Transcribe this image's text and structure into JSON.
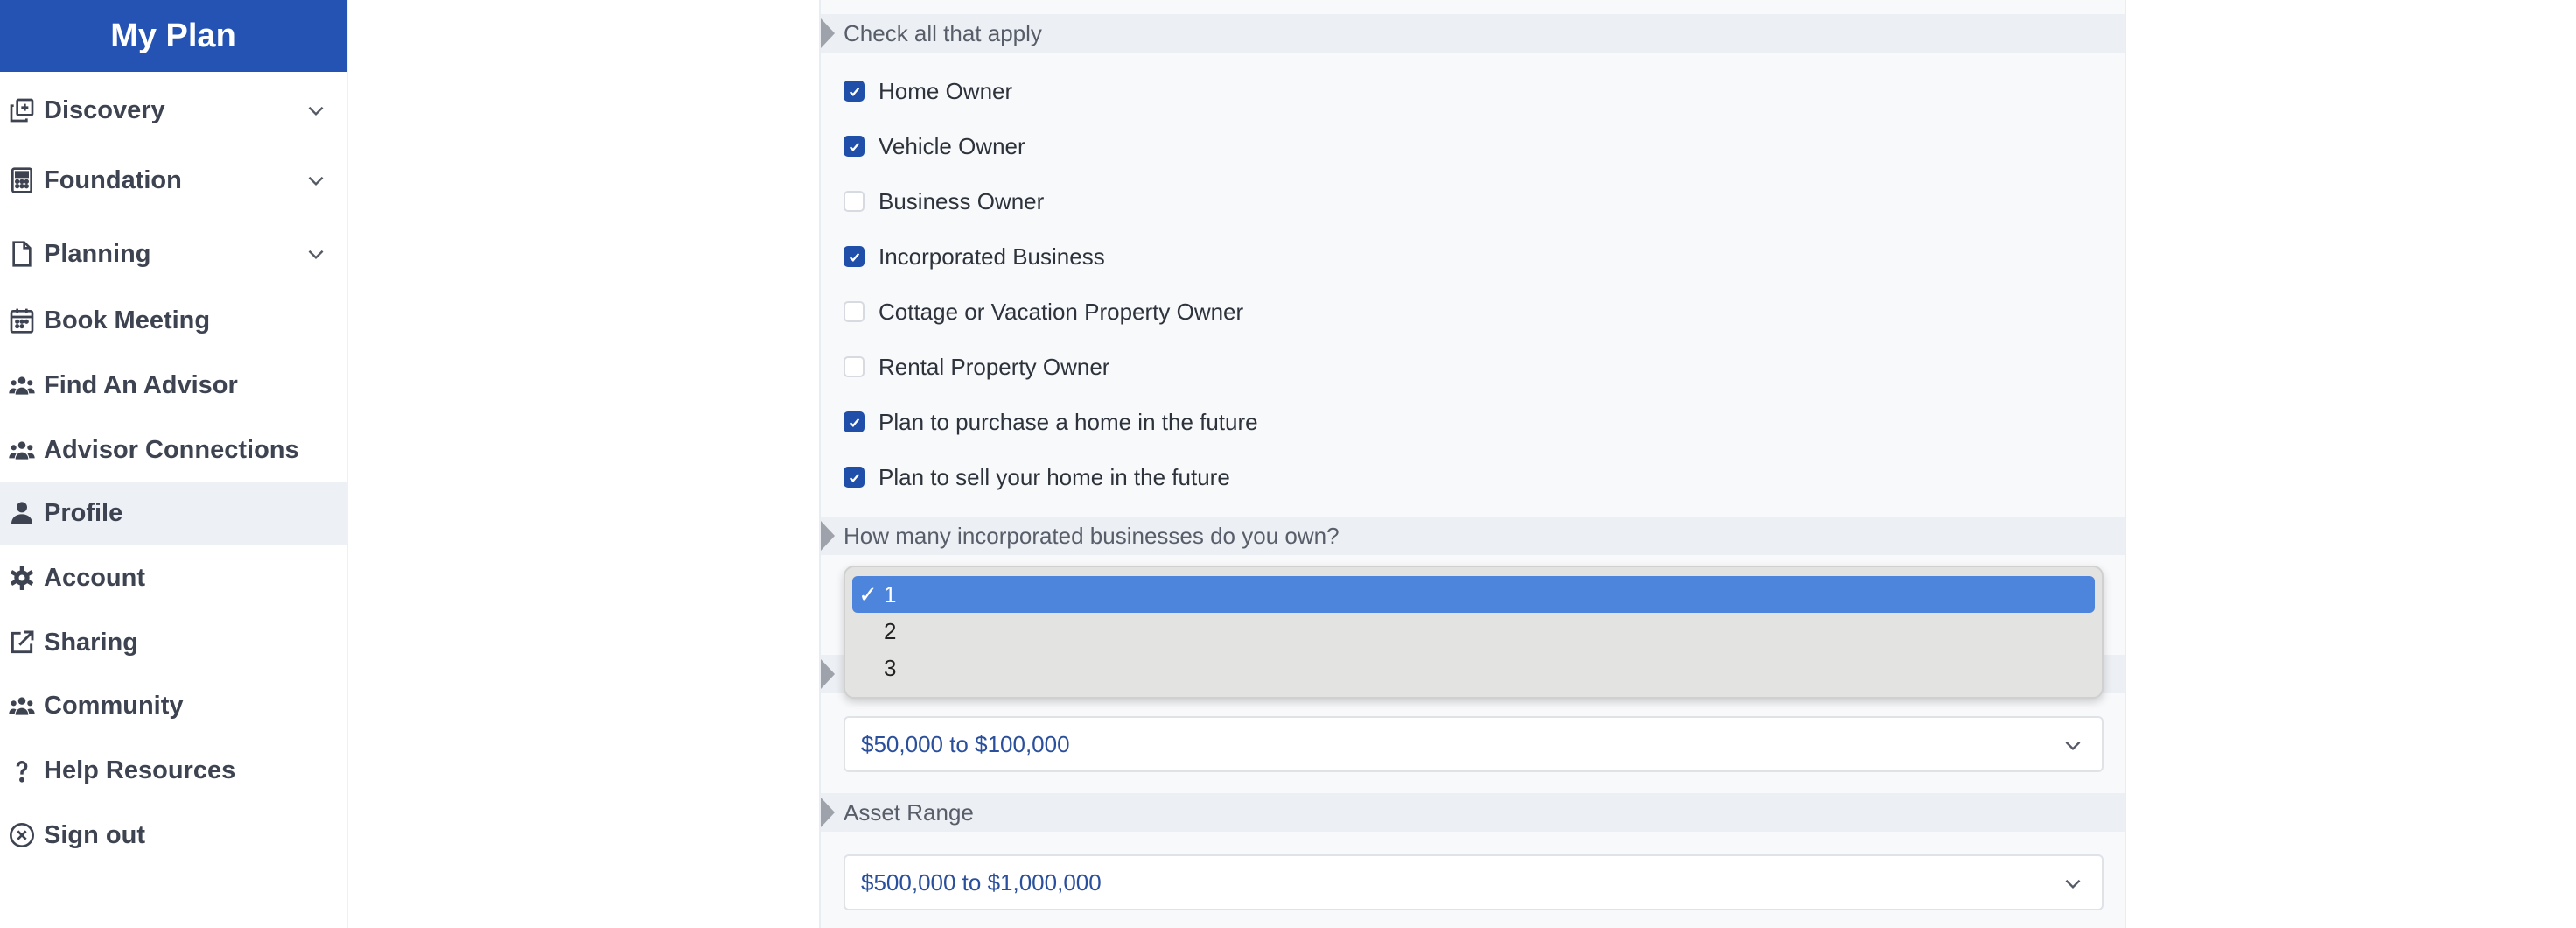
{
  "sidebar": {
    "title": "My Plan",
    "items": [
      {
        "label": "Discovery",
        "icon": "plus-square-icon",
        "expandable": true,
        "active": false
      },
      {
        "label": "Foundation",
        "icon": "calculator-icon",
        "expandable": true,
        "active": false
      },
      {
        "label": "Planning",
        "icon": "document-icon",
        "expandable": true,
        "active": false
      },
      {
        "label": "Book Meeting",
        "icon": "calendar-icon",
        "expandable": false,
        "active": false
      },
      {
        "label": "Find An Advisor",
        "icon": "users-icon",
        "expandable": false,
        "active": false
      },
      {
        "label": "Advisor Connections",
        "icon": "users-icon",
        "expandable": false,
        "active": false
      },
      {
        "label": "Profile",
        "icon": "user-icon",
        "expandable": false,
        "active": true
      },
      {
        "label": "Account",
        "icon": "gear-icon",
        "expandable": false,
        "active": false
      },
      {
        "label": "Sharing",
        "icon": "external-link-icon",
        "expandable": false,
        "active": false
      },
      {
        "label": "Community",
        "icon": "users-icon",
        "expandable": false,
        "active": false
      },
      {
        "label": "Help Resources",
        "icon": "question-icon",
        "expandable": false,
        "active": false
      },
      {
        "label": "Sign out",
        "icon": "close-circle-icon",
        "expandable": false,
        "active": false
      }
    ]
  },
  "form": {
    "checklist_heading": "Check all that apply",
    "checklist": [
      {
        "label": "Home Owner",
        "checked": true
      },
      {
        "label": "Vehicle Owner",
        "checked": true
      },
      {
        "label": "Business Owner",
        "checked": false
      },
      {
        "label": "Incorporated Business",
        "checked": true
      },
      {
        "label": "Cottage or Vacation Property Owner",
        "checked": false
      },
      {
        "label": "Rental Property Owner",
        "checked": false
      },
      {
        "label": "Plan to purchase a home in the future",
        "checked": true
      },
      {
        "label": "Plan to sell your home in the future",
        "checked": true
      }
    ],
    "businesses_heading": "How many incorporated businesses do you own?",
    "businesses_options": [
      {
        "label": "1",
        "selected": true
      },
      {
        "label": "2",
        "selected": false
      },
      {
        "label": "3",
        "selected": false
      }
    ],
    "income_value": "$50,000 to $100,000",
    "asset_heading": "Asset Range",
    "asset_value": "$500,000 to $1,000,000"
  },
  "colors": {
    "brand": "#2453b3",
    "checkbox": "#1f4fa8",
    "selected_option": "#4e85dc",
    "select_text": "#2a4f9c"
  }
}
